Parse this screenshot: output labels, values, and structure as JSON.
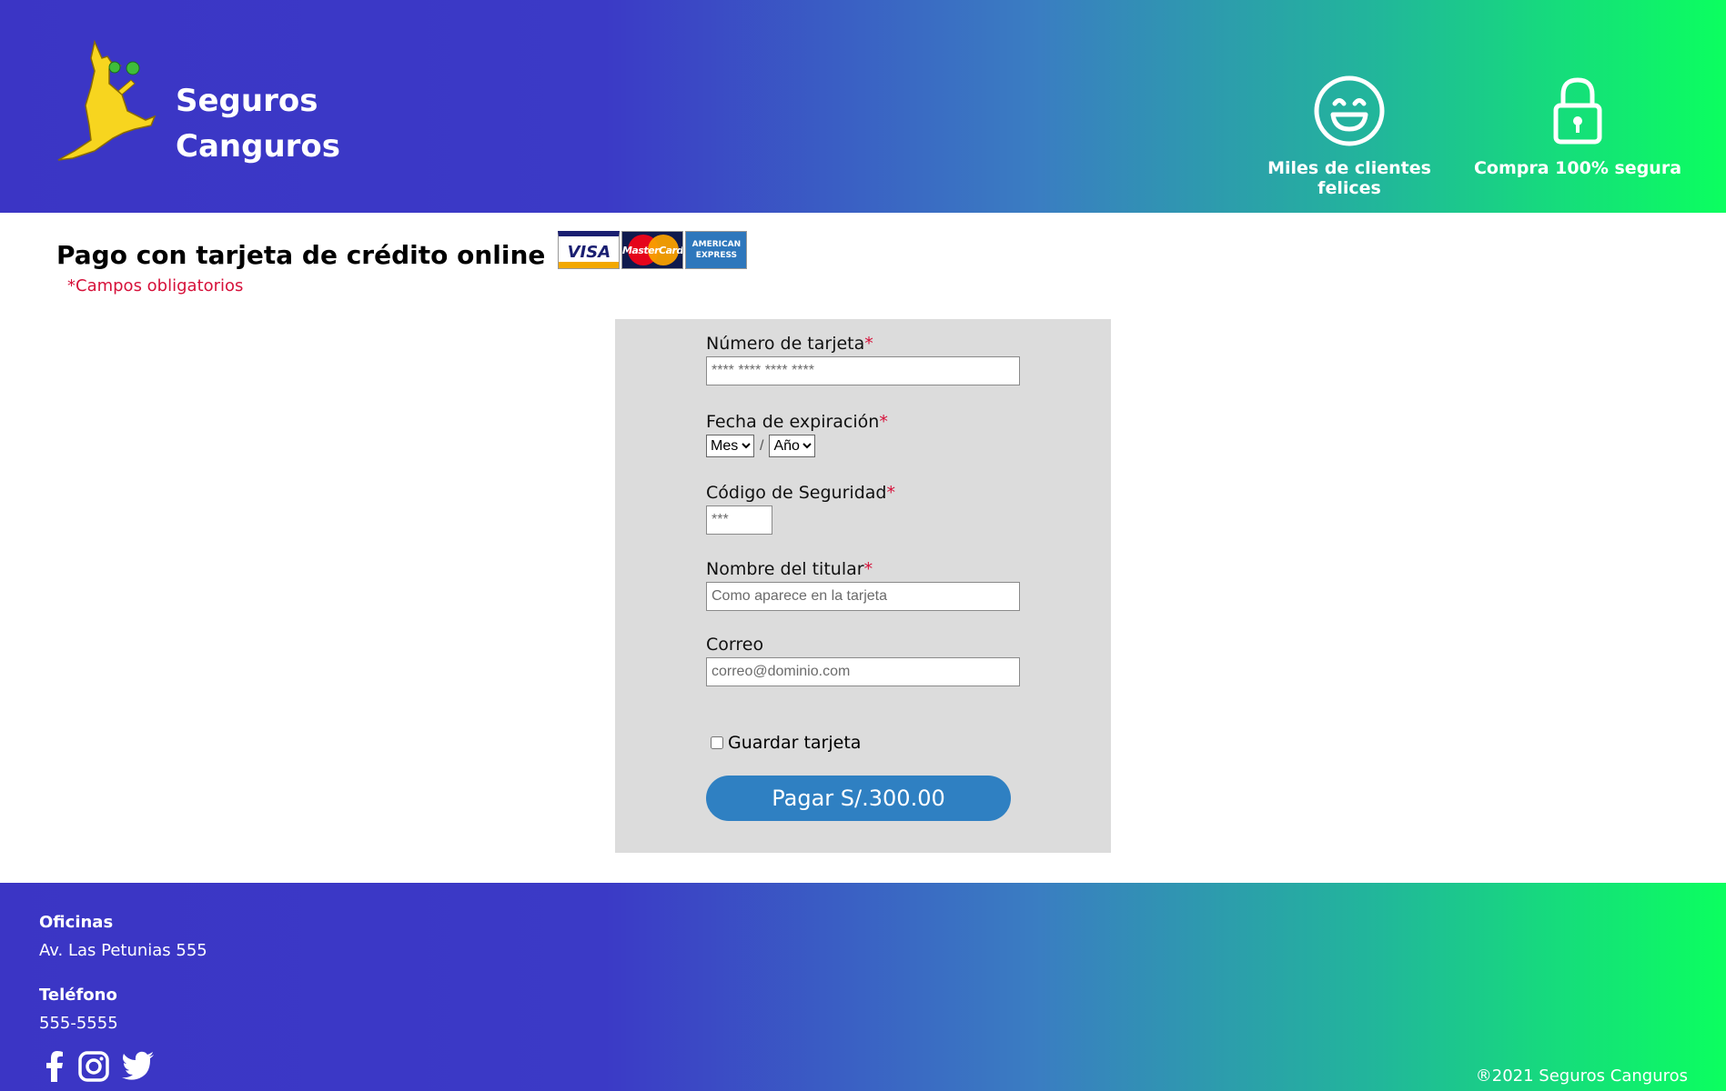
{
  "header": {
    "brand_line1": "Seguros",
    "brand_line2": "Canguros",
    "features": [
      {
        "label": "Miles de clientes felices",
        "icon": "smiley-icon"
      },
      {
        "label": "Compra 100% segura",
        "icon": "padlock-icon"
      }
    ]
  },
  "page": {
    "title": "Pago con tarjeta de crédito online",
    "required_note": "*Campos obligatorios",
    "card_logos": {
      "visa": "VISA",
      "mastercard": "MasterCard",
      "amex_line1": "AMERICAN",
      "amex_line2": "EXPRESS"
    }
  },
  "form": {
    "card_number": {
      "label": "Número de tarjeta",
      "required_mark": "*",
      "placeholder": "**** **** **** ****"
    },
    "expiry": {
      "label": "Fecha de expiración",
      "required_mark": "*",
      "month_selected": "Mes",
      "year_selected": "Año",
      "separator": "/"
    },
    "cvv": {
      "label": "Código de Seguridad",
      "required_mark": "*",
      "placeholder": "***"
    },
    "holder": {
      "label": "Nombre del titular",
      "required_mark": "*",
      "placeholder": "Como aparece en la tarjeta"
    },
    "email": {
      "label": "Correo",
      "placeholder": "correo@dominio.com"
    },
    "save_card_label": "Guardar tarjeta",
    "pay_button_label": "Pagar S/.300.00"
  },
  "footer": {
    "offices_heading": "Oficinas",
    "offices_address": "Av. Las Petunias 555",
    "phone_heading": "Teléfono",
    "phone_number": "555-5555",
    "social": [
      "facebook-icon",
      "instagram-icon",
      "twitter-icon"
    ],
    "copyright": "®2021 Seguros Canguros"
  },
  "colors": {
    "header_gradient_start": "#3b35c5",
    "header_gradient_end": "#0bff5f",
    "form_panel": "#dcdcdc",
    "button": "#2f80c2",
    "required": "#d6113a"
  }
}
